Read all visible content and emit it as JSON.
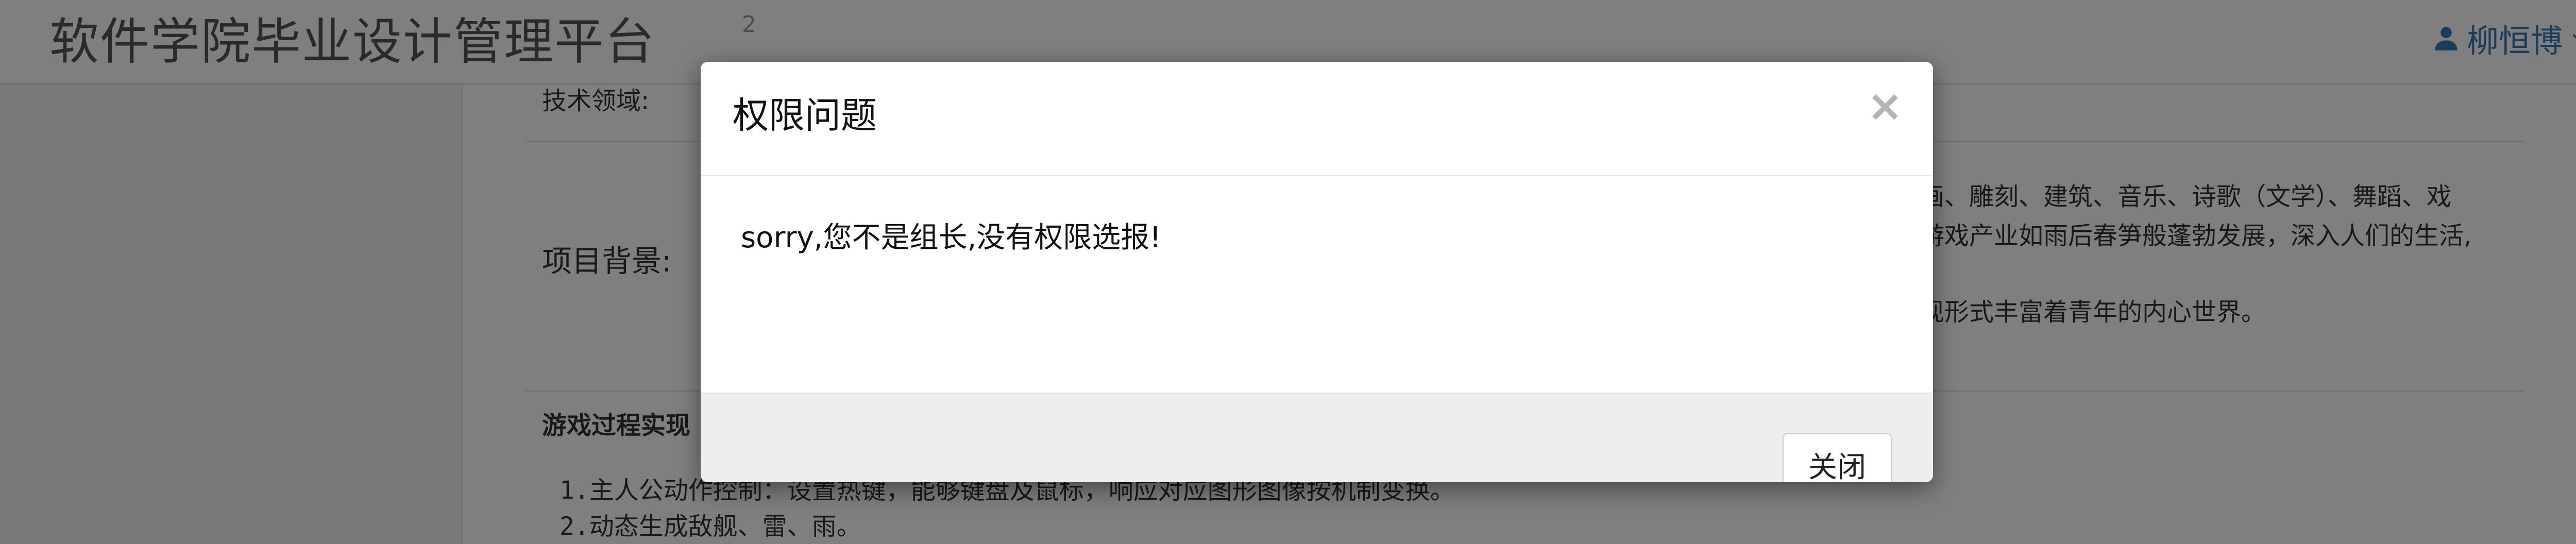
{
  "header": {
    "brand": "软件学院毕业设计管理平台",
    "nav_ghost": "2",
    "user_name": "柳恒博"
  },
  "project": {
    "tech_field_label": "技术领域:",
    "background_label": "项目背景:",
    "background_lines": [
      "画、雕刻、建筑、音乐、诗歌（文学）、舞蹈、戏",
      "游戏产业如雨后春笋般蓬勃发展，深入人们的生活,",
      "现形式丰富着青年的内心世界。"
    ],
    "game_process_label": "游戏过程实现",
    "steps": [
      {
        "num": "1.",
        "text": "主人公动作控制：设置热键，能够键盘及鼠标，响应对应图形图像按机制变换。"
      },
      {
        "num": "2.",
        "text": "动态生成敌舰、雷、雨。"
      }
    ]
  },
  "modal": {
    "title": "权限问题",
    "close_symbol": "×",
    "message": "sorry,您不是组长,没有权限选报!",
    "close_button": "关闭"
  },
  "colors": {
    "link_blue": "#337ab7",
    "backdrop": "rgba(0,0,0,0.5)",
    "footer_bg": "#eceeef"
  }
}
